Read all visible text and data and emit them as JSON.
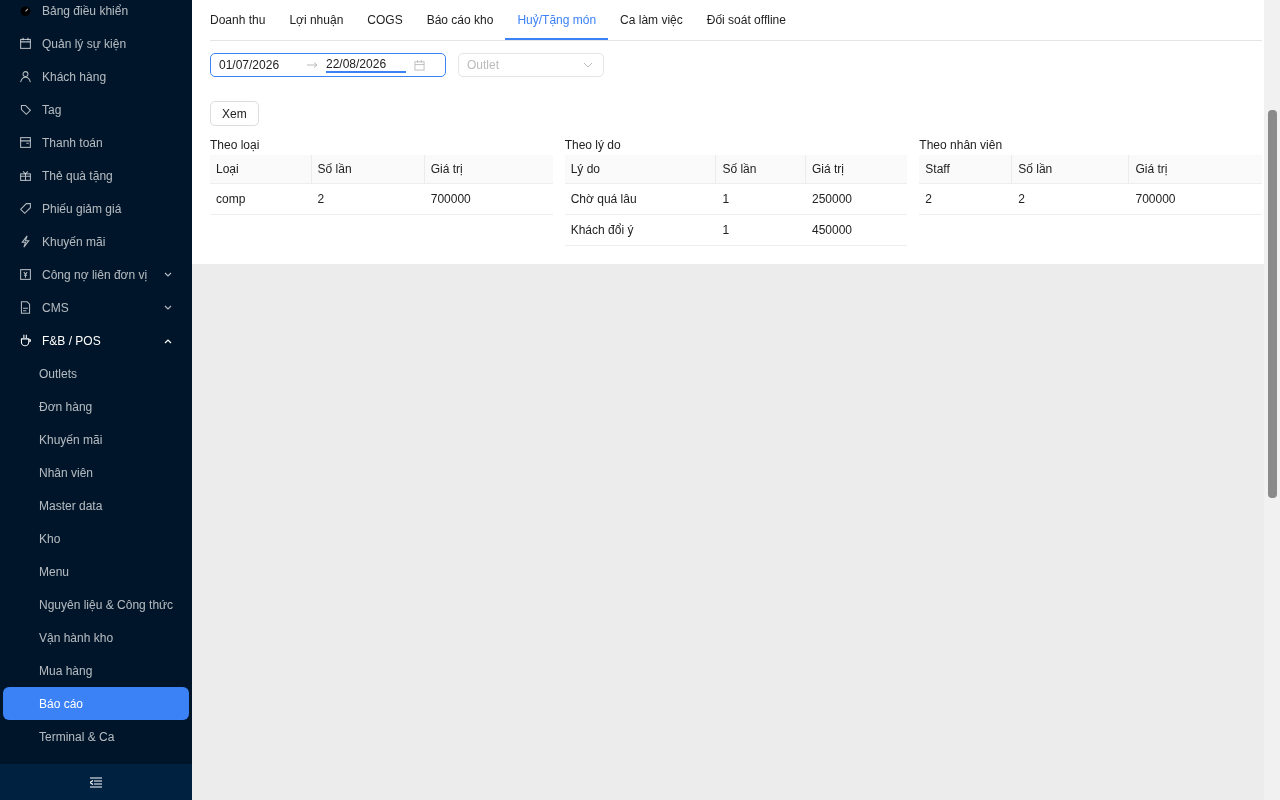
{
  "sidebar": {
    "items": [
      {
        "label": "Bảng điều khiển",
        "selected": false
      },
      {
        "label": "Quản lý sự kiện",
        "selected": false
      },
      {
        "label": "Khách hàng",
        "selected": false
      },
      {
        "label": "Tag",
        "selected": false
      },
      {
        "label": "Thanh toán",
        "selected": false
      },
      {
        "label": "Thẻ quà tặng",
        "selected": false
      },
      {
        "label": "Phiếu giảm giá",
        "selected": false
      },
      {
        "label": "Khuyến mãi",
        "selected": false
      },
      {
        "label": "Công nợ liên đơn vị",
        "selected": false,
        "expanded": false
      },
      {
        "label": "CMS",
        "selected": false,
        "expanded": false
      },
      {
        "label": "F&B / POS",
        "selected": false,
        "expanded": true,
        "children": [
          {
            "label": "Outlets",
            "selected": false
          },
          {
            "label": "Đơn hàng",
            "selected": false
          },
          {
            "label": "Khuyến mãi",
            "selected": false
          },
          {
            "label": "Nhân viên",
            "selected": false
          },
          {
            "label": "Master data",
            "selected": false
          },
          {
            "label": "Kho",
            "selected": false
          },
          {
            "label": "Menu",
            "selected": false
          },
          {
            "label": "Nguyên liệu & Công thức",
            "selected": false
          },
          {
            "label": "Vận hành kho",
            "selected": false
          },
          {
            "label": "Mua hàng",
            "selected": false
          },
          {
            "label": "Báo cáo",
            "selected": true
          },
          {
            "label": "Terminal & Ca",
            "selected": false
          }
        ]
      }
    ]
  },
  "tabs": [
    {
      "label": "Doanh thu",
      "selected": false
    },
    {
      "label": "Lợi nhuận",
      "selected": false
    },
    {
      "label": "COGS",
      "selected": false
    },
    {
      "label": "Báo cáo kho",
      "selected": false
    },
    {
      "label": "Huỷ/Tặng món",
      "selected": true
    },
    {
      "label": "Ca làm việc",
      "selected": false
    },
    {
      "label": "Đối soát offline",
      "selected": false
    }
  ],
  "filters": {
    "start_date": "01/07/2026",
    "end_date": "22/08/2026",
    "outlet": {
      "placeholder": "Outlet"
    },
    "view_button": "Xem"
  },
  "tables": [
    {
      "title": "Theo loại",
      "columns": [
        "Loại",
        "Số lần",
        "Giá trị"
      ],
      "rows": [
        [
          "comp",
          "2",
          "700000"
        ]
      ]
    },
    {
      "title": "Theo lý do",
      "columns": [
        "Lý do",
        "Số lần",
        "Giá trị"
      ],
      "rows": [
        [
          "Chờ quá lâu",
          "1",
          "250000"
        ],
        [
          "Khách đổi ý",
          "1",
          "450000"
        ]
      ]
    },
    {
      "title": "Theo nhân viên",
      "columns": [
        "Staff",
        "Số lần",
        "Giá trị"
      ],
      "rows": [
        [
          "2",
          "2",
          "700000"
        ]
      ]
    }
  ]
}
